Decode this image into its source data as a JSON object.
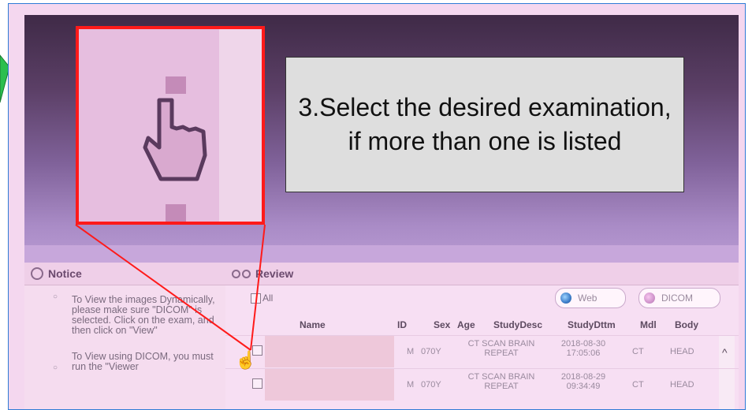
{
  "callout": {
    "text": "3.Select the desired examination, if more than one is listed"
  },
  "notice": {
    "title": "Notice",
    "paragraphs": [
      "To View the images Dynamically, please make sure \"DICOM\" is selected. Click on the exam, and then click on \"View\"",
      "To View using DICOM, you must run the \"Viewer"
    ]
  },
  "review": {
    "title": "Review",
    "all_label": "All",
    "options": {
      "web": "Web",
      "dicom": "DICOM"
    },
    "columns": {
      "name": "Name",
      "id": "ID",
      "sex": "Sex",
      "age": "Age",
      "studydesc": "StudyDesc",
      "studydttm": "StudyDttm",
      "mdl": "Mdl",
      "body": "Body"
    },
    "rows": [
      {
        "sex": "M",
        "age": "070Y",
        "studydesc_line1": "CT SCAN BRAIN",
        "studydesc_line2": "REPEAT",
        "studydttm_line1": "2018-08-30",
        "studydttm_line2": "17:05:06",
        "mdl": "CT",
        "body": "HEAD"
      },
      {
        "sex": "M",
        "age": "070Y",
        "studydesc_line1": "CT SCAN BRAIN",
        "studydesc_line2": "REPEAT",
        "studydttm_line1": "2018-08-29",
        "studydttm_line2": "09:34:49",
        "mdl": "CT",
        "body": "HEAD"
      }
    ]
  },
  "colors": {
    "callout_bg": "#dedede",
    "zoom_border": "#ff1a1a",
    "frame_border": "#2e7bd6",
    "arrow_green": "#2bbf4f"
  },
  "icons": {
    "notice": "speech-bubble-icon",
    "review": "binoculars-icon",
    "scroll": "chevron-up-icon",
    "cursor": "hand-pointer-icon"
  }
}
